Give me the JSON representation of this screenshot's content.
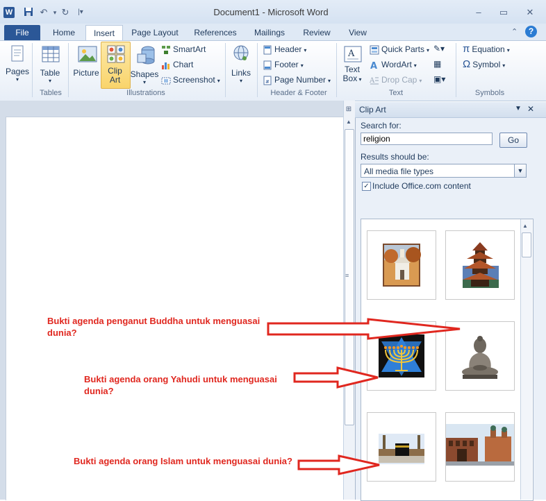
{
  "window": {
    "title": "Document1  -  Microsoft Word",
    "app_logo": "W"
  },
  "tabs": {
    "file": "File",
    "items": [
      "Home",
      "Insert",
      "Page Layout",
      "References",
      "Mailings",
      "Review",
      "View"
    ],
    "active": "Insert"
  },
  "ribbon": {
    "pages": "Pages",
    "table": "Table",
    "picture": "Picture",
    "clip_art_1": "Clip",
    "clip_art_2": "Art",
    "shapes": "Shapes",
    "smartart": "SmartArt",
    "chart": "Chart",
    "screenshot": "Screenshot",
    "links": "Links",
    "header": "Header",
    "footer": "Footer",
    "page_number": "Page Number",
    "text_box_1": "Text",
    "text_box_2": "Box",
    "quick_parts": "Quick Parts",
    "wordart": "WordArt",
    "drop_cap": "Drop Cap",
    "equation": "Equation",
    "symbol": "Symbol",
    "groups": {
      "tables": "Tables",
      "illustrations": "Illustrations",
      "header_footer": "Header & Footer",
      "text": "Text",
      "symbols": "Symbols"
    }
  },
  "clipart": {
    "title": "Clip Art",
    "search_label": "Search for:",
    "search_value": "religion",
    "go": "Go",
    "results_label": "Results should be:",
    "media_type": "All media file types",
    "include_office": "Include Office.com content",
    "include_checked": "✓"
  },
  "annotations": {
    "buddha_1": "Bukti agenda penganut Buddha untuk menguasai",
    "buddha_2": "dunia?",
    "jewish_1": "Bukti agenda orang Yahudi untuk menguasai",
    "jewish_2": "dunia?",
    "islam": "Bukti agenda orang Islam untuk menguasai dunia?"
  },
  "colors": {
    "accent": "#2b5797",
    "annotation": "#e0271f"
  }
}
